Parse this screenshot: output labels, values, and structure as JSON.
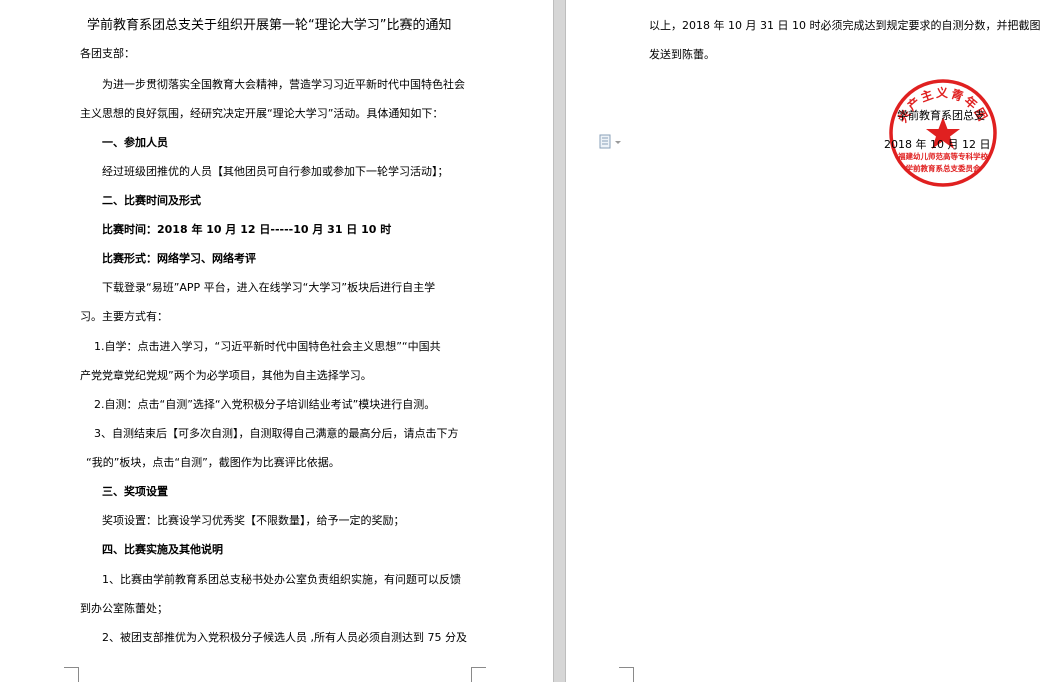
{
  "document": {
    "title": "学前教育系团总支关于组织开展第一轮“理论大学习”比赛的通知",
    "salutation": "各团支部：",
    "paragraphs": [
      "为进一步贯彻落实全国教育大会精神，营造学习习近平新时代中国特色社会",
      "主义思想的良好氛围，经研究决定开展“理论大学习”活动。具体通知如下：",
      "一、参加人员",
      "经过班级团推优的人员【其他团员可自行参加或参加下一轮学习活动】；",
      "二、比赛时间及形式",
      "比赛时间：2018 年 10 月 12 日-----10 月 31 日 10 时",
      "比赛形式：网络学习、网络考评",
      "下载登录“易班”APP 平台，进入在线学习“大学习”板块后进行自主学",
      "习。主要方式有：",
      "1.自学：点击进入学习，“习近平新时代中国特色社会主义思想”“中国共",
      "产党党章党纪党规”两个为必学项目，其他为自主选择学习。",
      "2.自测：点击“自测”选择“入党积极分子培训结业考试”模块进行自测。",
      "3、自测结束后【可多次自测】，自测取得自己满意的最高分后，请点击下方",
      "“我的”板块，点击“自测”，截图作为比赛评比依据。",
      "三、奖项设置",
      "奖项设置：比赛设学习优秀奖【不限数量】，给予一定的奖励；",
      "四、比赛实施及其他说明",
      "1、比赛由学前教育系团总支秘书处办公室负责组织实施，有问题可以反馈",
      "到办公室陈蕾处；",
      "2、被团支部推优为入党积极分子候选人员 ,所有人员必须自测达到 75 分及"
    ],
    "continuation": [
      "以上，2018 年 10 月 31 日 10 时必须完成达到规定要求的自测分数，并把截图",
      "发送到陈蕾。"
    ],
    "signature": {
      "organization": "学前教育系团总支",
      "date": "2018 年 10 月 12 日"
    },
    "stamp": {
      "text_top": "共产主义青年团",
      "text_bottom": "福建幼儿师范高等专科学校",
      "text_bottom2": "学前教育系总支委员会",
      "color": "#e02020"
    }
  },
  "icons": {
    "paste_options": "paste-options-icon"
  },
  "colors": {
    "gutter": "#d6d6d6",
    "page": "#ffffff",
    "text": "#000000"
  }
}
